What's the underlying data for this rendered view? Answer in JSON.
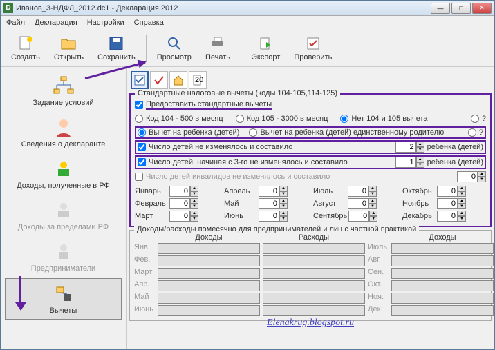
{
  "title": "Иванов_3-НДФЛ_2012.dc1 - Декларация 2012",
  "menu": [
    "Файл",
    "Декларация",
    "Настройки",
    "Справка"
  ],
  "toolbar": [
    {
      "label": "Создать",
      "icon": "new"
    },
    {
      "label": "Открыть",
      "icon": "open"
    },
    {
      "label": "Сохранить",
      "icon": "save"
    },
    {
      "sep": true
    },
    {
      "label": "Просмотр",
      "icon": "view"
    },
    {
      "label": "Печать",
      "icon": "print"
    },
    {
      "sep": true
    },
    {
      "label": "Экспорт",
      "icon": "export"
    },
    {
      "label": "Проверить",
      "icon": "check"
    }
  ],
  "sidebar": [
    {
      "label": "Задание условий",
      "active": false
    },
    {
      "label": "Сведения о декларанте",
      "active": false
    },
    {
      "label": "Доходы, полученные в РФ",
      "active": false
    },
    {
      "label": "Доходы за пределами РФ",
      "dim": true
    },
    {
      "label": "Предприниматели",
      "dim": true
    },
    {
      "label": "Вычеты",
      "active": true
    }
  ],
  "group1": {
    "title": "Стандартные налоговые вычеты (коды 104-105,114-125)",
    "chk_std": "Предоставить стандартные вычеты",
    "r104": "Код 104 - 500 в месяц",
    "r105": "Код 105 - 3000 в месяц",
    "rnone": "Нет 104 и 105 вычета",
    "q1": "?",
    "rchild": "Вычет на ребенка (детей)",
    "rchild1": "Вычет на ребенка (детей) единственному родителю",
    "q2": "?",
    "chk_count": "Число детей не изменялось и составило",
    "count_val": "2",
    "count_suffix": "ребенка (детей)",
    "chk_from3": "Число детей, начиная с 3-го не изменялось и составило",
    "from3_val": "1",
    "from3_suffix": "ребенка (детей)",
    "chk_inv": "Число детей инвалидов не изменялось и составило",
    "inv_val": "0",
    "months_r1": [
      "Январь",
      "Апрель",
      "Июль",
      "Октябрь"
    ],
    "months_r2": [
      "Февраль",
      "Май",
      "Август",
      "Ноябрь"
    ],
    "months_r3": [
      "Март",
      "Июнь",
      "Сентябрь",
      "Декабрь"
    ],
    "mval": "0"
  },
  "group2": {
    "title": "Доходы/расходы помесячно для предпринимателей и лиц с частной практикой",
    "h1": "Доходы",
    "h2": "Расходы",
    "rows_l": [
      "Янв.",
      "Фев.",
      "Март",
      "Апр.",
      "Май",
      "Июнь"
    ],
    "rows_r": [
      "Июль",
      "Авг.",
      "Сен.",
      "Окт.",
      "Ноя.",
      "Дек."
    ]
  },
  "watermark": "Elenakrug.blogspot.ru"
}
